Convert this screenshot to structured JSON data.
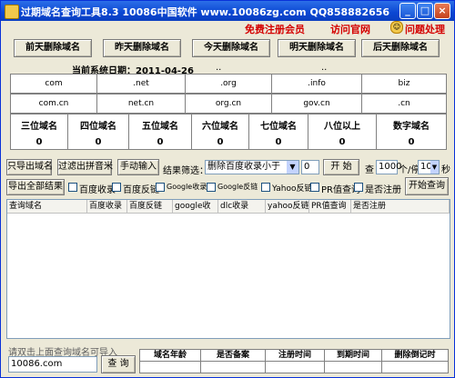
{
  "window": {
    "title": "过期域名查询工具8.3     10086中国软件  www.10086zg.com    QQ858882656",
    "minimize": "_",
    "maximize": "□",
    "close": "×"
  },
  "top_links": {
    "register": "免费注册会员",
    "official": "访问官网",
    "help": "问题处理"
  },
  "day_buttons": [
    "前天删除域名",
    "昨天删除域名",
    "今天删除域名",
    "明天删除域名",
    "后天删除域名"
  ],
  "system_date": "当前系统日期：2011-04-26",
  "dots": [
    "..",
    ".."
  ],
  "tld_row1": [
    "com",
    ".net",
    ".org",
    ".info",
    "biz"
  ],
  "tld_row2": [
    "com.cn",
    "net.cn",
    "org.cn",
    "gov.cn",
    ".cn"
  ],
  "length_headers": [
    "三位域名",
    "四位域名",
    "五位域名",
    "六位域名",
    "七位域名",
    "八位以上",
    "数字域名"
  ],
  "length_counts": [
    "0",
    "0",
    "0",
    "0",
    "0",
    "0",
    "0"
  ],
  "filter_bar": {
    "export_domains": "只导出域名",
    "filter_pinyin": "过滤出拼音米",
    "manual_input": "手动输入",
    "result_filter_label": "结果筛选：",
    "filter_select": "删除百度收录小于",
    "filter_value": "0",
    "start": "开 始",
    "check_label": "查",
    "check_count": "1000",
    "per_label": "个/停",
    "pause_value": "10",
    "seconds": "秒"
  },
  "options_bar": {
    "export_all": "导出全部结果",
    "options": [
      "百度收录",
      "百度反链",
      "Google收录",
      "Google反链",
      "Yahoo反链",
      "PR值查询",
      "是否注册"
    ],
    "start_query": "开始查询"
  },
  "table_headers": [
    "查询域名",
    "百度收录",
    "百度反链",
    "google收",
    "dlc收录",
    "yahoo反链",
    "PR值查询",
    "是否注册"
  ],
  "bottom": {
    "hint": "请双击上面查询域名可导入",
    "domain_input": "10086.com",
    "query_button": "查 询",
    "info_headers": [
      "域名年龄",
      "是否备案",
      "注册时间",
      "到期时间",
      "删除倒记时"
    ]
  }
}
